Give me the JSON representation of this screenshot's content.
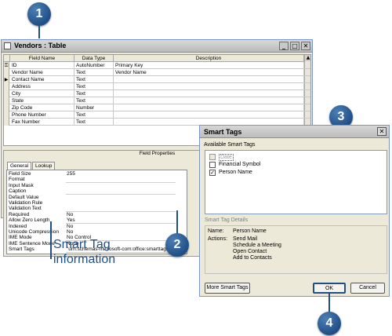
{
  "callouts": [
    "1",
    "2",
    "3",
    "4"
  ],
  "annotation": {
    "line1": "Smart Tag",
    "line2": "information"
  },
  "table_window": {
    "title": "Vendors : Table",
    "buttons": {
      "minimize": "_",
      "maximize": "□",
      "close": "✕"
    },
    "columns": [
      "Field Name",
      "Data Type",
      "Description"
    ],
    "rows": [
      {
        "field": "ID",
        "type": "AutoNumber",
        "desc": "Primary Key",
        "key": true
      },
      {
        "field": "Vendor Name",
        "type": "Text",
        "desc": "Vendor Name"
      },
      {
        "field": "Contact Name",
        "type": "Text",
        "desc": "",
        "current": true
      },
      {
        "field": "Address",
        "type": "Text",
        "desc": ""
      },
      {
        "field": "City",
        "type": "Text",
        "desc": ""
      },
      {
        "field": "State",
        "type": "Text",
        "desc": ""
      },
      {
        "field": "Zip Code",
        "type": "Number",
        "desc": ""
      },
      {
        "field": "Phone Number",
        "type": "Text",
        "desc": ""
      },
      {
        "field": "Fax Number",
        "type": "Text",
        "desc": ""
      }
    ],
    "field_properties_label": "Field Properties",
    "tabs": [
      "General",
      "Lookup"
    ],
    "properties": [
      {
        "label": "Field Size",
        "value": "255"
      },
      {
        "label": "Format",
        "value": ""
      },
      {
        "label": "Input Mask",
        "value": ""
      },
      {
        "label": "Caption",
        "value": ""
      },
      {
        "label": "Default Value",
        "value": ""
      },
      {
        "label": "Validation Rule",
        "value": ""
      },
      {
        "label": "Validation Text",
        "value": ""
      },
      {
        "label": "Required",
        "value": "No"
      },
      {
        "label": "Allow Zero Length",
        "value": "Yes"
      },
      {
        "label": "Indexed",
        "value": "No"
      },
      {
        "label": "Unicode Compression",
        "value": "No"
      },
      {
        "label": "IME Mode",
        "value": "No Control"
      },
      {
        "label": "IME Sentence Mode",
        "value": "None"
      },
      {
        "label": "Smart Tags",
        "value": "\"urn:schemas-microsoft-com:office:smarttags#PersonName\""
      }
    ],
    "builder_button": "..."
  },
  "dialog": {
    "title": "Smart Tags",
    "available_label": "Available Smart Tags",
    "items": [
      {
        "label": "Date",
        "checked": false,
        "disabled": true
      },
      {
        "label": "Financial Symbol",
        "checked": false
      },
      {
        "label": "Person Name",
        "checked": true
      }
    ],
    "details_label": "Smart Tag Details",
    "name_label": "Name:",
    "name_value": "Person Name",
    "actions_label": "Actions:",
    "actions": [
      "Send Mail",
      "Schedule a Meeting",
      "Open Contact",
      "Add to Contacts"
    ],
    "more_button": "More Smart Tags",
    "ok_button": "OK",
    "cancel_button": "Cancel"
  }
}
